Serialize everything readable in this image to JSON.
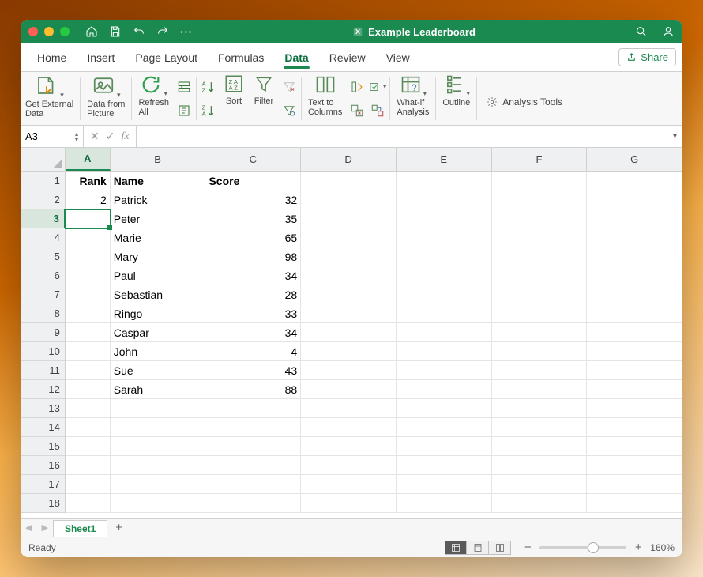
{
  "title": "Example Leaderboard",
  "menubar": [
    "Home",
    "Insert",
    "Page Layout",
    "Formulas",
    "Data",
    "Review",
    "View"
  ],
  "menubar_active": "Data",
  "share_label": "Share",
  "ribbon": {
    "get_external_data": "Get External\nData",
    "data_from_picture": "Data from\nPicture",
    "refresh_all": "Refresh\nAll",
    "sort": "Sort",
    "filter": "Filter",
    "text_to_columns": "Text to\nColumns",
    "whatif": "What-if\nAnalysis",
    "outline": "Outline",
    "analysis_tools": "Analysis Tools"
  },
  "namebox": "A3",
  "formula": "",
  "columns": [
    "A",
    "B",
    "C",
    "D",
    "E",
    "F",
    "G"
  ],
  "selected_col": "A",
  "selected_row": 3,
  "rows_visible": 18,
  "headers": {
    "A": "Rank",
    "B": "Name",
    "C": "Score"
  },
  "data": [
    {
      "row": 2,
      "A": "2",
      "B": "Patrick",
      "C": "32"
    },
    {
      "row": 3,
      "A": "",
      "B": "Peter",
      "C": "35"
    },
    {
      "row": 4,
      "A": "",
      "B": "Marie",
      "C": "65"
    },
    {
      "row": 5,
      "A": "",
      "B": "Mary",
      "C": "98"
    },
    {
      "row": 6,
      "A": "",
      "B": "Paul",
      "C": "34"
    },
    {
      "row": 7,
      "A": "",
      "B": "Sebastian",
      "C": "28"
    },
    {
      "row": 8,
      "A": "",
      "B": "Ringo",
      "C": "33"
    },
    {
      "row": 9,
      "A": "",
      "B": "Caspar",
      "C": "34"
    },
    {
      "row": 10,
      "A": "",
      "B": "John",
      "C": "4"
    },
    {
      "row": 11,
      "A": "",
      "B": "Sue",
      "C": "43"
    },
    {
      "row": 12,
      "A": "",
      "B": "Sarah",
      "C": "88"
    }
  ],
  "sheet_tab": "Sheet1",
  "status": "Ready",
  "zoom": "160%",
  "colors": {
    "brand": "#1b8a50"
  }
}
